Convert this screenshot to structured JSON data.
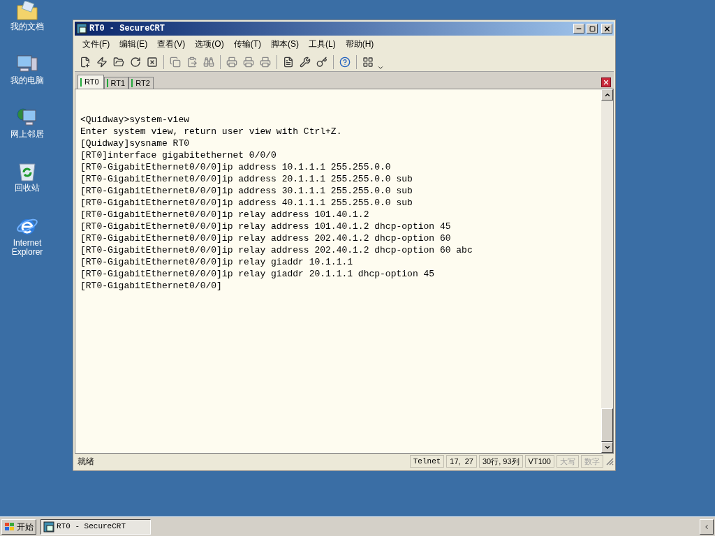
{
  "desktop_icons": [
    {
      "kind": "folder",
      "label": "我的文档"
    },
    {
      "kind": "computer",
      "label": "我的电脑"
    },
    {
      "kind": "network",
      "label": "网上邻居"
    },
    {
      "kind": "recycle",
      "label": "回收站"
    },
    {
      "kind": "browser",
      "label": "Internet Explorer"
    }
  ],
  "window": {
    "title": "RT0 - SecureCRT"
  },
  "menu": [
    "文件(F)",
    "编辑(E)",
    "查看(V)",
    "选项(O)",
    "传输(T)",
    "脚本(S)",
    "工具(L)",
    "帮助(H)"
  ],
  "tabs": [
    {
      "label": "RT0",
      "selected": true
    },
    {
      "label": "RT1",
      "selected": false
    },
    {
      "label": "RT2",
      "selected": false
    }
  ],
  "terminal": {
    "lines": [
      "<Quidway>system-view",
      "Enter system view, return user view with Ctrl+Z.",
      "[Quidway]sysname RT0",
      "[RT0]interface gigabitethernet 0/0/0",
      "[RT0-GigabitEthernet0/0/0]ip address 10.1.1.1 255.255.0.0",
      "[RT0-GigabitEthernet0/0/0]ip address 20.1.1.1 255.255.0.0 sub",
      "[RT0-GigabitEthernet0/0/0]ip address 30.1.1.1 255.255.0.0 sub",
      "[RT0-GigabitEthernet0/0/0]ip address 40.1.1.1 255.255.0.0 sub",
      "[RT0-GigabitEthernet0/0/0]ip relay address 101.40.1.2",
      "[RT0-GigabitEthernet0/0/0]ip relay address 101.40.1.2 dhcp-option 45",
      "[RT0-GigabitEthernet0/0/0]ip relay address 202.40.1.2 dhcp-option 60",
      "[RT0-GigabitEthernet0/0/0]ip relay address 202.40.1.2 dhcp-option 60 abc",
      "[RT0-GigabitEthernet0/0/0]ip relay giaddr 10.1.1.1",
      "[RT0-GigabitEthernet0/0/0]ip relay giaddr 20.1.1.1 dhcp-option 45",
      "[RT0-GigabitEthernet0/0/0]"
    ]
  },
  "status_bar": {
    "message": "就绪",
    "fields": [
      {
        "text": "Telnet",
        "disabled": false
      },
      {
        "text": "17,  27",
        "disabled": false
      },
      {
        "text": "30行, 93列",
        "disabled": false
      },
      {
        "text": "VT100",
        "disabled": false
      },
      {
        "text": "大写",
        "disabled": true
      },
      {
        "text": "数字",
        "disabled": true
      }
    ]
  },
  "taskbar": {
    "start": "开始",
    "tasks": [
      {
        "label": "RT0 - SecureCRT"
      }
    ]
  }
}
